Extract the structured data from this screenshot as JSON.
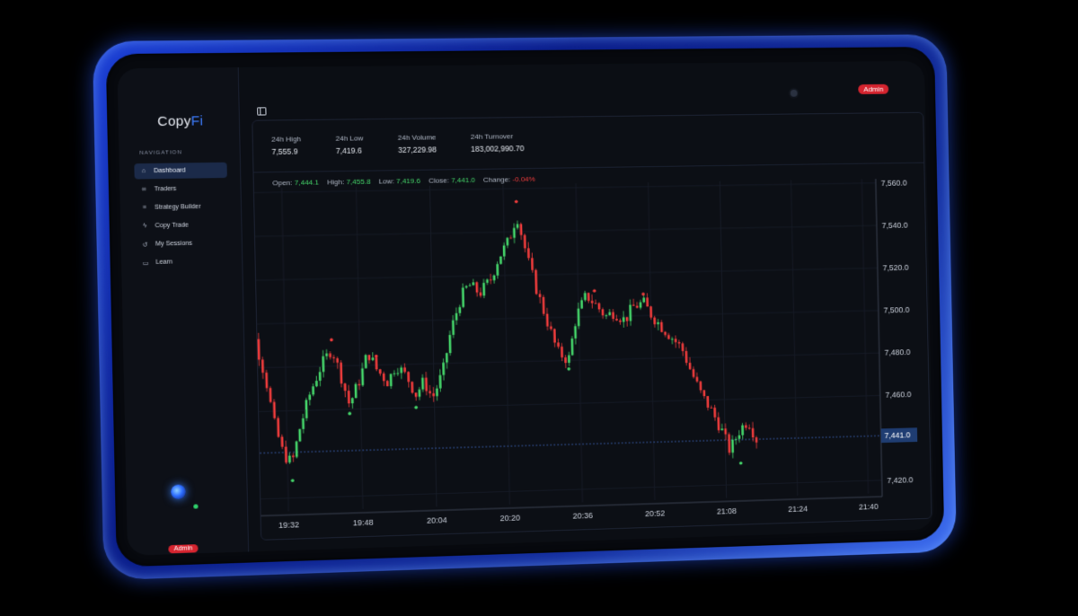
{
  "app": {
    "brand_prefix": "Copy",
    "brand_suffix": "Fi",
    "admin_badge_top": "Admin",
    "admin_badge_bottom": "Admin"
  },
  "sidebar": {
    "heading": "NAVIGATION",
    "items": [
      {
        "label": "Dashboard",
        "icon": "home-icon",
        "active": true
      },
      {
        "label": "Traders",
        "icon": "users-icon",
        "active": false
      },
      {
        "label": "Strategy Builder",
        "icon": "sliders-icon",
        "active": false
      },
      {
        "label": "Copy Trade",
        "icon": "lightning-icon",
        "active": false
      },
      {
        "label": "My Sessions",
        "icon": "history-icon",
        "active": false
      },
      {
        "label": "Learn",
        "icon": "book-icon",
        "active": false
      }
    ]
  },
  "stats": [
    {
      "label": "24h High",
      "value": "7,555.9"
    },
    {
      "label": "24h Low",
      "value": "7,419.6"
    },
    {
      "label": "24h Volume",
      "value": "327,229.98"
    },
    {
      "label": "24h Turnover",
      "value": "183,002,990.70"
    }
  ],
  "ohlc": {
    "open_label": "Open:",
    "open": "7,444.1",
    "high_label": "High:",
    "high": "7,455.8",
    "low_label": "Low:",
    "low": "7,419.6",
    "close_label": "Close:",
    "close": "7,441.0",
    "change_label": "Change:",
    "change": "-0.04%"
  },
  "colors": {
    "up": "#45d56a",
    "down": "#ef3c3c",
    "accent": "#3d7dff",
    "badge": "#d5242f"
  },
  "chart_data": {
    "type": "candlestick",
    "x_tick_labels": [
      "19:32",
      "19:48",
      "20:04",
      "20:20",
      "20:36",
      "20:52",
      "21:08",
      "21:24",
      "21:40"
    ],
    "y_tick_labels": [
      "7,560.0",
      "7,540.0",
      "7,520.0",
      "7,500.0",
      "7,480.0",
      "7,460.0",
      "7,441.0",
      "7,420.0"
    ],
    "y_ticks": [
      7560,
      7540,
      7520,
      7500,
      7480,
      7460,
      7420
    ],
    "ylim": [
      7414,
      7562
    ],
    "last_price": 7441.0,
    "last_price_label": "7,441.0",
    "grid": true,
    "close_path": [
      [
        19.35,
        7522
      ],
      [
        19.38,
        7512
      ],
      [
        19.42,
        7496
      ],
      [
        19.46,
        7476
      ],
      [
        19.49,
        7454
      ],
      [
        19.52,
        7440
      ],
      [
        19.55,
        7436
      ],
      [
        19.58,
        7452
      ],
      [
        19.62,
        7468
      ],
      [
        19.66,
        7480
      ],
      [
        19.7,
        7488
      ],
      [
        19.73,
        7476
      ],
      [
        19.76,
        7462
      ],
      [
        19.8,
        7474
      ],
      [
        19.83,
        7486
      ],
      [
        19.86,
        7478
      ],
      [
        19.9,
        7472
      ],
      [
        19.93,
        7480
      ],
      [
        19.97,
        7474
      ],
      [
        20.0,
        7466
      ],
      [
        20.03,
        7472
      ],
      [
        20.06,
        7464
      ],
      [
        20.1,
        7476
      ],
      [
        20.13,
        7494
      ],
      [
        20.17,
        7510
      ],
      [
        20.2,
        7516
      ],
      [
        20.24,
        7512
      ],
      [
        20.28,
        7518
      ],
      [
        20.31,
        7528
      ],
      [
        20.35,
        7536
      ],
      [
        20.38,
        7548
      ],
      [
        20.42,
        7526
      ],
      [
        20.45,
        7512
      ],
      [
        20.49,
        7496
      ],
      [
        20.52,
        7484
      ],
      [
        20.56,
        7480
      ],
      [
        20.59,
        7500
      ],
      [
        20.63,
        7510
      ],
      [
        20.66,
        7506
      ],
      [
        20.7,
        7500
      ],
      [
        20.73,
        7502
      ],
      [
        20.77,
        7498
      ],
      [
        20.8,
        7504
      ],
      [
        20.84,
        7506
      ],
      [
        20.87,
        7500
      ],
      [
        20.91,
        7494
      ],
      [
        20.94,
        7490
      ],
      [
        20.98,
        7484
      ],
      [
        21.01,
        7474
      ],
      [
        21.05,
        7462
      ],
      [
        21.08,
        7456
      ],
      [
        21.12,
        7446
      ],
      [
        21.15,
        7436
      ],
      [
        21.19,
        7446
      ],
      [
        21.22,
        7450
      ],
      [
        21.25,
        7441
      ]
    ]
  }
}
